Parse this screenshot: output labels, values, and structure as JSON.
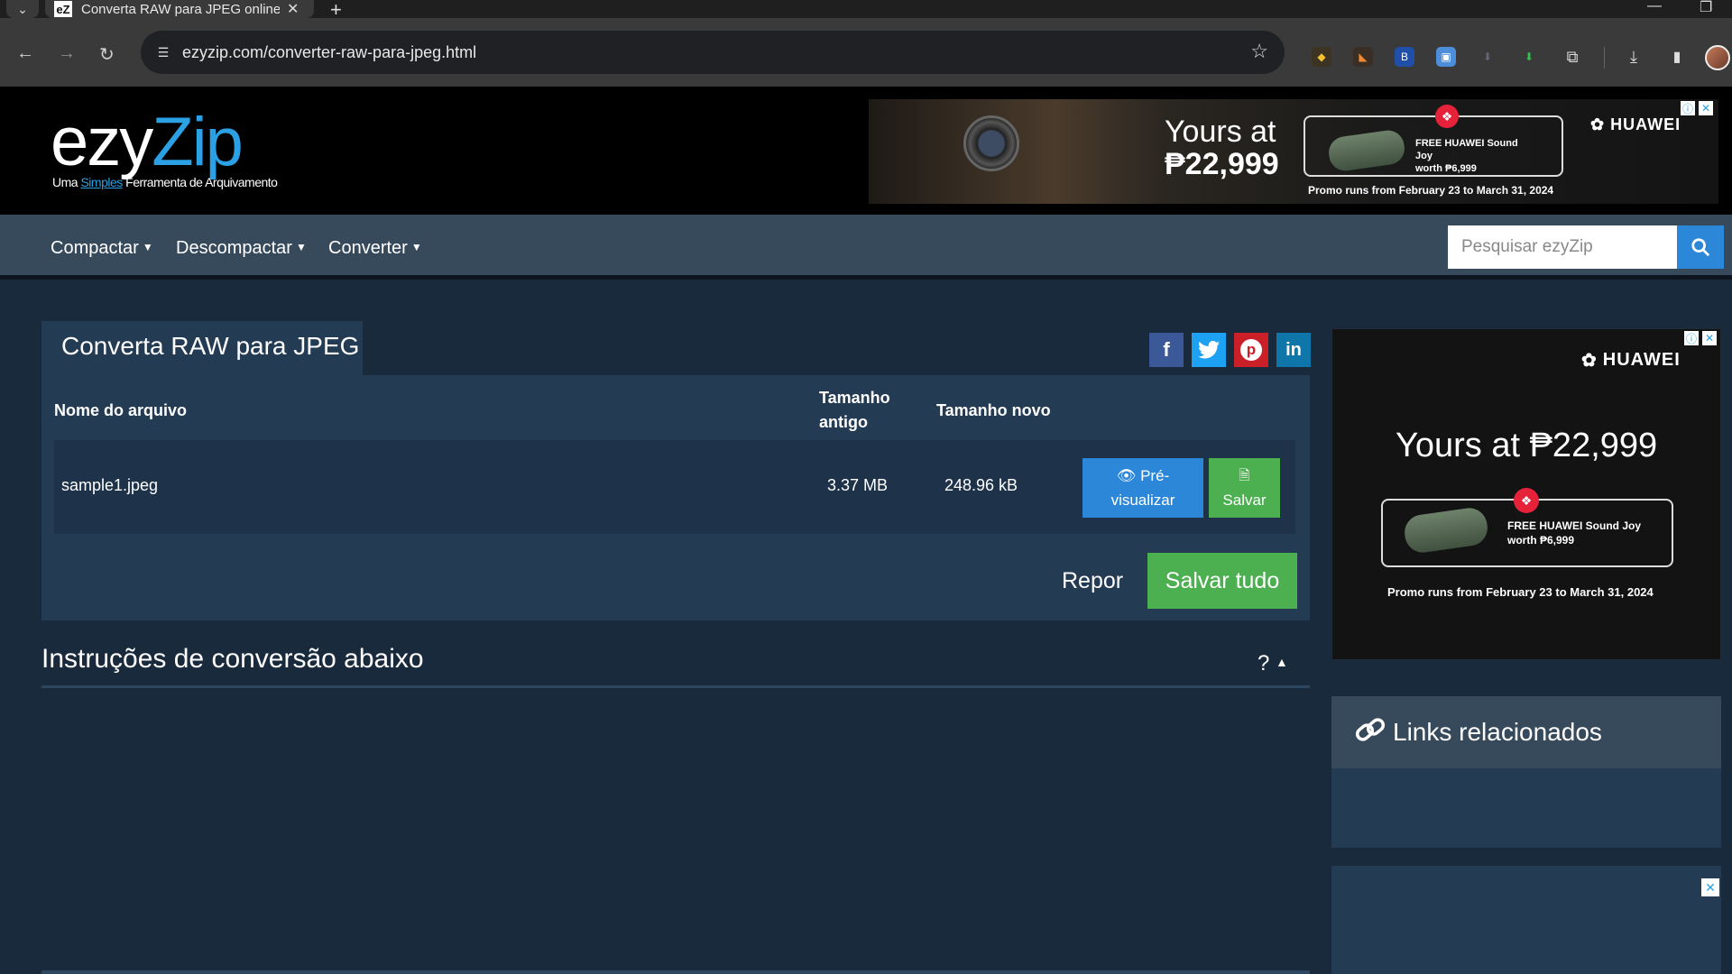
{
  "browser": {
    "tab_title": "Converta RAW para JPEG online",
    "tab_favicon": "eZ",
    "url": "ezyzip.com/converter-raw-para-jpeg.html"
  },
  "logo": {
    "ezy": "ezy",
    "zip": "Zip",
    "tagline_pre": "Uma ",
    "tagline_simples": "Simples",
    "tagline_post": " Ferramenta de Arquivamento"
  },
  "top_ad": {
    "price_line1": "Yours at",
    "price_line2": "₱22,999",
    "brand": "HUAWEI",
    "box_line1": "FREE HUAWEI Sound Joy",
    "box_line2": "worth ₱6,999",
    "promo": "Promo runs from February 23 to March 31, 2024"
  },
  "nav": {
    "items": [
      "Compactar",
      "Descompactar",
      "Converter"
    ],
    "search_placeholder": "Pesquisar ezyZip"
  },
  "panel": {
    "title": "Converta RAW para JPEG",
    "columns": {
      "filename": "Nome do arquivo",
      "old_size_1": "Tamanho",
      "old_size_2": "antigo",
      "new_size": "Tamanho novo"
    },
    "rows": [
      {
        "filename": "sample1.jpeg",
        "old_size": "3.37 MB",
        "new_size": "248.96 kB",
        "preview_1": "Pré-",
        "preview_2": "visualizar",
        "save": "Salvar"
      }
    ],
    "reset": "Repor",
    "save_all": "Salvar tudo"
  },
  "instructions": {
    "title": "Instruções de conversão abaixo",
    "help": "?"
  },
  "side_ad": {
    "brand": "HUAWEI",
    "price": "Yours at ₱22,999",
    "box_line1": "FREE HUAWEI Sound Joy",
    "box_line2": "worth ₱6,999",
    "promo": "Promo runs from February 23 to March 31, 2024"
  },
  "related": {
    "title": "Links relacionados"
  },
  "colors": {
    "page_bg": "#192a3c",
    "panel_bg": "#243b54",
    "nav_bg": "#374a5b",
    "accent_blue": "#2d87d9",
    "accent_green": "#4caf50",
    "logo_blue": "#2ba0e4"
  },
  "icons": {
    "social": [
      "facebook-icon",
      "twitter-icon",
      "pinterest-icon",
      "linkedin-icon"
    ]
  }
}
